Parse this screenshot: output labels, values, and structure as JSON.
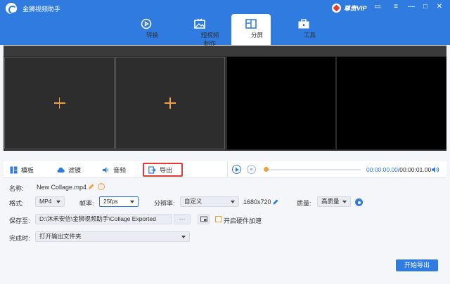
{
  "app": {
    "title": "金狮视频助手",
    "vip_label": "尊贵VIP",
    "accent": "#2f7be0"
  },
  "window_controls": {
    "chat": "▭",
    "menu": "≡",
    "minimize": "—",
    "maximize": "□",
    "close": "✕"
  },
  "nav": {
    "tabs": [
      {
        "label": "转换",
        "icon": "convert-icon"
      },
      {
        "label": "短视频制作",
        "icon": "image-video-icon"
      },
      {
        "label": "分屏",
        "icon": "split-screen-icon",
        "active": true
      },
      {
        "label": "工具",
        "icon": "toolbox-icon"
      }
    ]
  },
  "editor": {
    "tabs": [
      {
        "label": "模板",
        "icon": "template-icon"
      },
      {
        "label": "滤镜",
        "icon": "filter-cloud-icon"
      },
      {
        "label": "音频",
        "icon": "audio-icon"
      },
      {
        "label": "导出",
        "icon": "export-icon",
        "highlighted": true
      }
    ],
    "timecode_current": "00:00:00.00",
    "timecode_total": "/00:00:01.00",
    "progress": 0
  },
  "settings": {
    "name_label": "名称:",
    "name_value": "New Collage.mp4",
    "format_label": "格式:",
    "format_value": "MP4",
    "framerate_label": "帧率:",
    "framerate_value": "25fps",
    "resolution_label": "分辨率:",
    "resolution_value": "自定义",
    "resolution_size": "1680x720",
    "quality_label": "质量:",
    "quality_value": "高质量",
    "save_label": "保存至:",
    "save_path": "D:\\沐禾安信\\金狮视频助手\\Collage Exported",
    "browse_label": "···",
    "hw_accel_label": "开启硬件加速",
    "hw_accel_checked": false,
    "done_label": "完成时:",
    "done_value": "打开输出文件夹",
    "start_export": "开始导出"
  }
}
